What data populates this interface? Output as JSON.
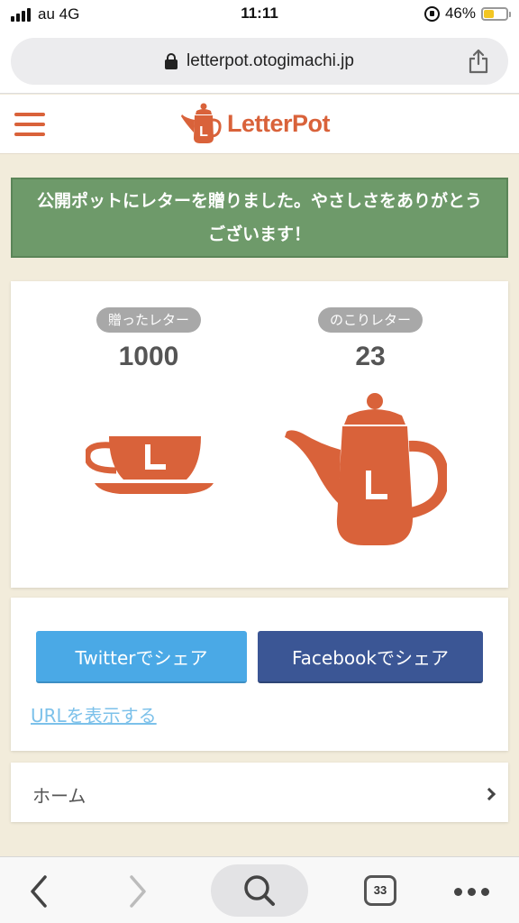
{
  "status": {
    "carrier": "au 4G",
    "time": "11:11",
    "battery_percent": "46%",
    "battery_level": 0.46
  },
  "browser": {
    "url": "letterpot.otogimachi.jp",
    "tab_count": "33"
  },
  "header": {
    "logo_text": "LetterPot",
    "accent_color": "#d9623a"
  },
  "banner": {
    "message": "公開ポットにレターを贈りました。やさしさをありがとうございます！",
    "background_color": "#6e9a6a"
  },
  "stats": {
    "sent": {
      "label": "贈ったレター",
      "value": "1000"
    },
    "remaining": {
      "label": "のこりレター",
      "value": "23"
    }
  },
  "share": {
    "twitter_label": "Twitterでシェア",
    "facebook_label": "Facebookでシェア",
    "show_url_label": "URLを表示する",
    "twitter_color": "#4aa9e6",
    "facebook_color": "#3b5695"
  },
  "nav": {
    "home_label": "ホーム"
  }
}
